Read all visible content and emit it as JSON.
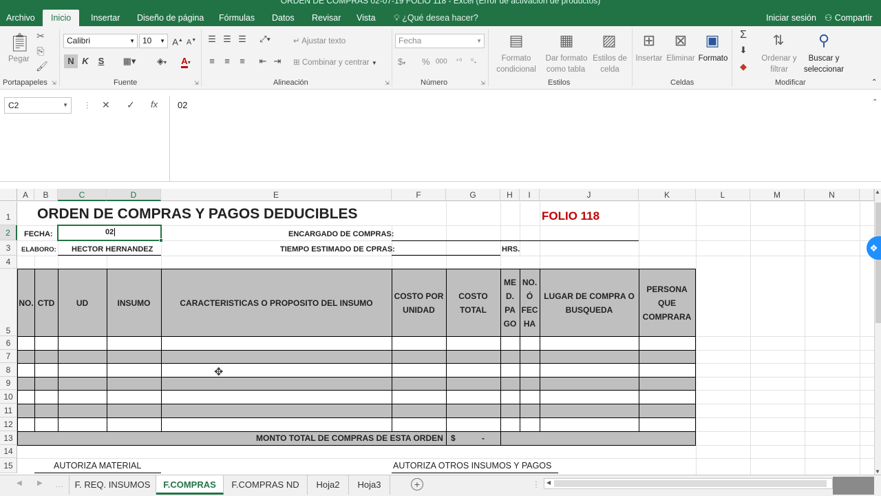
{
  "window": {
    "title": "ORDEN DE COMPRAS 02-07-19 FOLIO 118 - Excel (Error de activación de productos)"
  },
  "ribbon_tabs": [
    "Archivo",
    "Inicio",
    "Insertar",
    "Diseño de página",
    "Fórmulas",
    "Datos",
    "Revisar",
    "Vista"
  ],
  "tell_me": "¿Qué desea hacer?",
  "sign_in": "Iniciar sesión",
  "share": "Compartir",
  "clipboard": {
    "paste": "Pegar",
    "group": "Portapapeles"
  },
  "font": {
    "name": "Calibri",
    "size": "10",
    "bold": "N",
    "italic": "K",
    "underline": "S",
    "group": "Fuente"
  },
  "alignment": {
    "wrap": "Ajustar texto",
    "merge": "Combinar y centrar",
    "group": "Alineación"
  },
  "number": {
    "format": "Fecha",
    "currency": "$",
    "percent": "%",
    "thousands": "000",
    "group": "Número"
  },
  "styles": {
    "conditional_l1": "Formato",
    "conditional_l2": "condicional",
    "table_l1": "Dar formato",
    "table_l2": "como tabla",
    "cell_l1": "Estilos de",
    "cell_l2": "celda",
    "group": "Estilos"
  },
  "cells": {
    "insert": "Insertar",
    "delete": "Eliminar",
    "format": "Formato",
    "group": "Celdas"
  },
  "editing": {
    "sort_l1": "Ordenar y",
    "sort_l2": "filtrar",
    "find_l1": "Buscar y",
    "find_l2": "seleccionar",
    "group": "Modificar"
  },
  "formula_bar": {
    "name_box": "C2",
    "cancel": "✕",
    "enter": "✓",
    "fx": "fx",
    "value": "02"
  },
  "columns": [
    "A",
    "B",
    "C",
    "D",
    "E",
    "F",
    "G",
    "H",
    "I",
    "J",
    "K",
    "L",
    "M",
    "N"
  ],
  "rows": [
    "1",
    "2",
    "3",
    "4",
    "5",
    "6",
    "7",
    "8",
    "9",
    "10",
    "11",
    "12",
    "13",
    "14",
    "15"
  ],
  "sheet": {
    "title": "ORDEN DE COMPRAS Y PAGOS DEDUCIBLES",
    "folio": "FOLIO 118",
    "fecha_label": "FECHA:",
    "fecha_value": "02",
    "elaboro_label": "ELABORO:",
    "elaboro_value": "HECTOR HERNANDEZ",
    "encargado_label": "ENCARGADO DE COMPRAS:",
    "tiempo_label": "TIEMPO ESTIMADO DE CPRAS:",
    "hrs": "HRS.",
    "headers": {
      "no": "NO.",
      "ctd": "CTD",
      "ud": "UD",
      "insumo": "INSUMO",
      "caracteristicas": "CARACTERISTICAS O PROPOSITO DEL INSUMO",
      "costo_unidad_1": "COSTO POR",
      "costo_unidad_2": "UNIDAD",
      "costo_total_1": "COSTO",
      "costo_total_2": "TOTAL",
      "med_1": "ME",
      "med_2": "D.",
      "med_3": "PA",
      "med_4": "GO",
      "nofecha_1": "NO.",
      "nofecha_2": "Ó",
      "nofecha_3": "FEC",
      "nofecha_4": "HA",
      "lugar_1": "LUGAR DE COMPRA O",
      "lugar_2": "BUSQUEDA",
      "persona_1": "PERSONA",
      "persona_2": "QUE",
      "persona_3": "COMPRARA"
    },
    "total_label": "MONTO TOTAL DE COMPRAS DE ESTA ORDEN",
    "total_currency": "$",
    "total_value": "-",
    "autoriza_material": "AUTORIZA MATERIAL",
    "autoriza_otros": "AUTORIZA OTROS INSUMOS Y PAGOS"
  },
  "sheet_tabs": [
    "F. REQ. INSUMOS",
    "F.COMPRAS",
    "F.COMPRAS ND",
    "Hoja2",
    "Hoja3"
  ],
  "active_sheet": "F.COMPRAS",
  "colors": {
    "excel_green": "#217346",
    "gray_fill": "#bfbfbf",
    "folio_red": "#c00000"
  }
}
